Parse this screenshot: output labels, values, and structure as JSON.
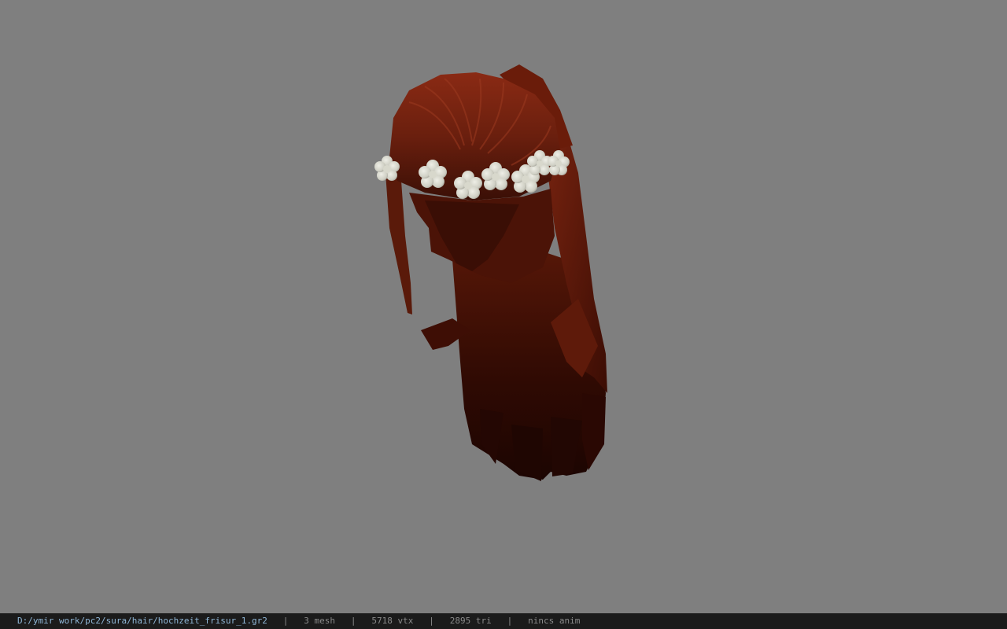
{
  "viewport": {
    "background": "#7f7f7f",
    "model_name": "hair-with-flower-crown"
  },
  "statusbar": {
    "path": "D:/ymir work/pc2/sura/hair/hochzeit_frisur_1.gr2",
    "separator": "|",
    "mesh": "3 mesh",
    "vertices": "5718 vtx",
    "triangles": "2895 tri",
    "anim": "nincs anim",
    "path_color": "#8fb6d6",
    "text_color": "#8a8a8a"
  }
}
